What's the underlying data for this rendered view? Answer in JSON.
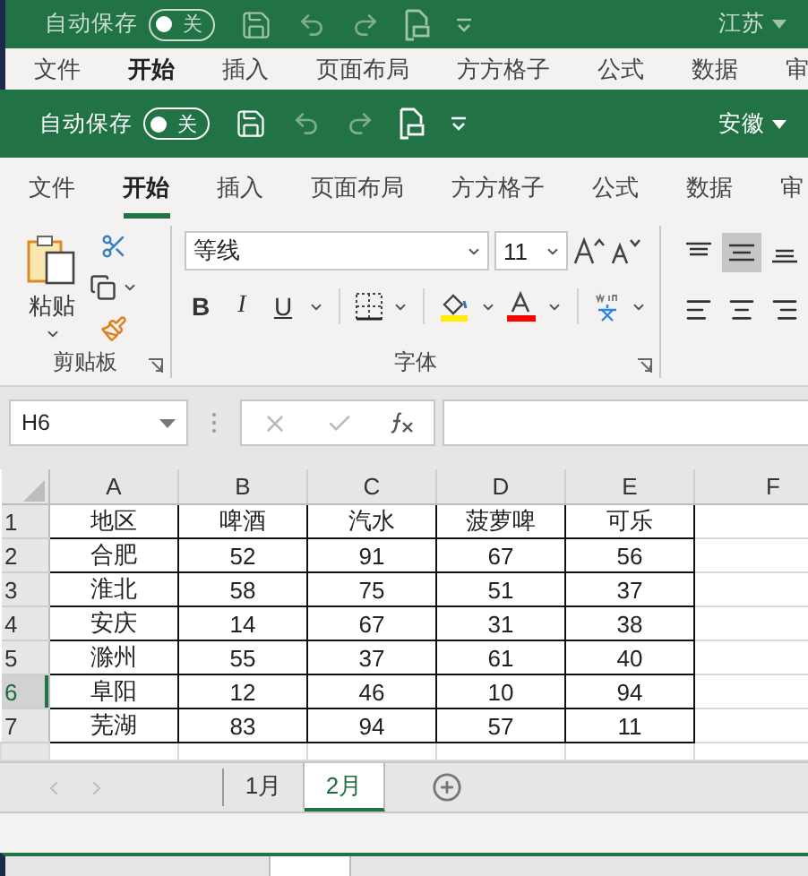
{
  "back_window": {
    "autosave": {
      "label": "自动保存",
      "toggle": "关",
      "on": false
    },
    "location": "江苏",
    "tabs": [
      {
        "label": "文件",
        "selected": false
      },
      {
        "label": "开始",
        "selected": true
      },
      {
        "label": "插入",
        "selected": false
      },
      {
        "label": "页面布局",
        "selected": false
      },
      {
        "label": "方方格子",
        "selected": false
      },
      {
        "label": "公式",
        "selected": false
      },
      {
        "label": "数据",
        "selected": false
      },
      {
        "label": "审",
        "selected": false
      }
    ]
  },
  "window": {
    "autosave": {
      "label": "自动保存",
      "toggle": "关",
      "on": false
    },
    "location": "安徽"
  },
  "ribbon": {
    "tabs": [
      {
        "label": "文件",
        "selected": false
      },
      {
        "label": "开始",
        "selected": true
      },
      {
        "label": "插入",
        "selected": false
      },
      {
        "label": "页面布局",
        "selected": false
      },
      {
        "label": "方方格子",
        "selected": false
      },
      {
        "label": "公式",
        "selected": false
      },
      {
        "label": "数据",
        "selected": false
      },
      {
        "label": "审",
        "selected": false
      }
    ],
    "clipboard": {
      "paste": "粘贴",
      "group": "剪贴板"
    },
    "font": {
      "name": "等线",
      "size": "11",
      "bold": "B",
      "italic": "I",
      "underline": "U",
      "group": "字体"
    }
  },
  "formula_bar": {
    "name_box": "H6"
  },
  "sheet": {
    "columns": [
      "A",
      "B",
      "C",
      "D",
      "E",
      "F"
    ],
    "rows": [
      {
        "header": "1",
        "selected": false,
        "cells": [
          "地区",
          "啤酒",
          "汽水",
          "菠萝啤",
          "可乐"
        ]
      },
      {
        "header": "2",
        "selected": false,
        "cells": [
          "合肥",
          "52",
          "91",
          "67",
          "56"
        ]
      },
      {
        "header": "3",
        "selected": false,
        "cells": [
          "淮北",
          "58",
          "75",
          "51",
          "37"
        ]
      },
      {
        "header": "4",
        "selected": false,
        "cells": [
          "安庆",
          "14",
          "67",
          "31",
          "38"
        ]
      },
      {
        "header": "5",
        "selected": false,
        "cells": [
          "滁州",
          "55",
          "37",
          "61",
          "40"
        ]
      },
      {
        "header": "6",
        "selected": true,
        "cells": [
          "阜阳",
          "12",
          "46",
          "10",
          "94"
        ]
      },
      {
        "header": "7",
        "selected": false,
        "cells": [
          "芜湖",
          "83",
          "94",
          "57",
          "11"
        ]
      }
    ]
  },
  "sheet_tabs": [
    {
      "label": "1月",
      "selected": false
    },
    {
      "label": "2月",
      "selected": true
    }
  ]
}
